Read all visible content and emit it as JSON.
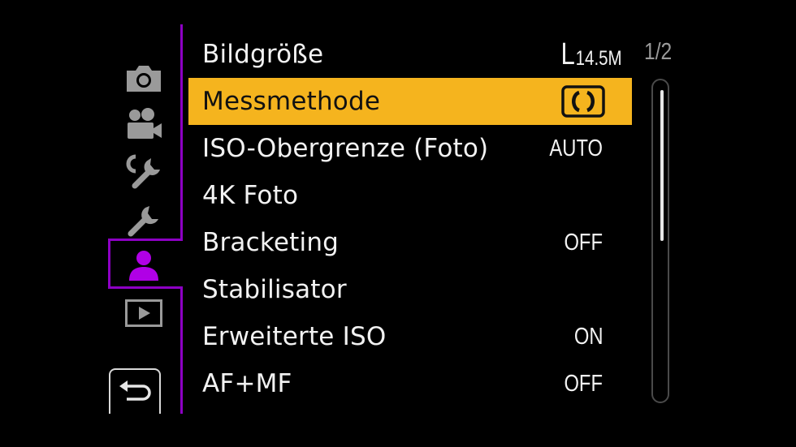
{
  "pager": {
    "current": "1/2"
  },
  "scrollbar": {
    "thumb_fraction": 0.5
  },
  "sidebar": {
    "tabs": [
      {
        "name": "photo",
        "icon": "camera-icon",
        "active": false
      },
      {
        "name": "video",
        "icon": "video-camera-icon",
        "active": false
      },
      {
        "name": "custom",
        "icon": "custom-wrench-icon",
        "active": false
      },
      {
        "name": "setup",
        "icon": "wrench-icon",
        "active": false
      },
      {
        "name": "my-menu",
        "icon": "person-icon",
        "active": true
      },
      {
        "name": "playback",
        "icon": "playback-icon",
        "active": false
      }
    ],
    "back_icon": "return-arrow-icon"
  },
  "colors": {
    "accent": "#8d00c4",
    "selection": "#f5b41e",
    "background": "#000000",
    "text": "#f2f2f2"
  },
  "menu": {
    "items": [
      {
        "label": "Bildgröße",
        "value_big": "L",
        "value_small": "14.5M"
      },
      {
        "label": "Messmethode",
        "value_icon": "center-weighted-metering-icon",
        "selected": true
      },
      {
        "label": "ISO-Obergrenze (Foto)",
        "value": "AUTO"
      },
      {
        "label": "4K Foto",
        "value": ""
      },
      {
        "label": "Bracketing",
        "value": "OFF"
      },
      {
        "label": "Stabilisator",
        "value": ""
      },
      {
        "label": "Erweiterte ISO",
        "value": "ON"
      },
      {
        "label": "AF+MF",
        "value": "OFF"
      }
    ]
  }
}
